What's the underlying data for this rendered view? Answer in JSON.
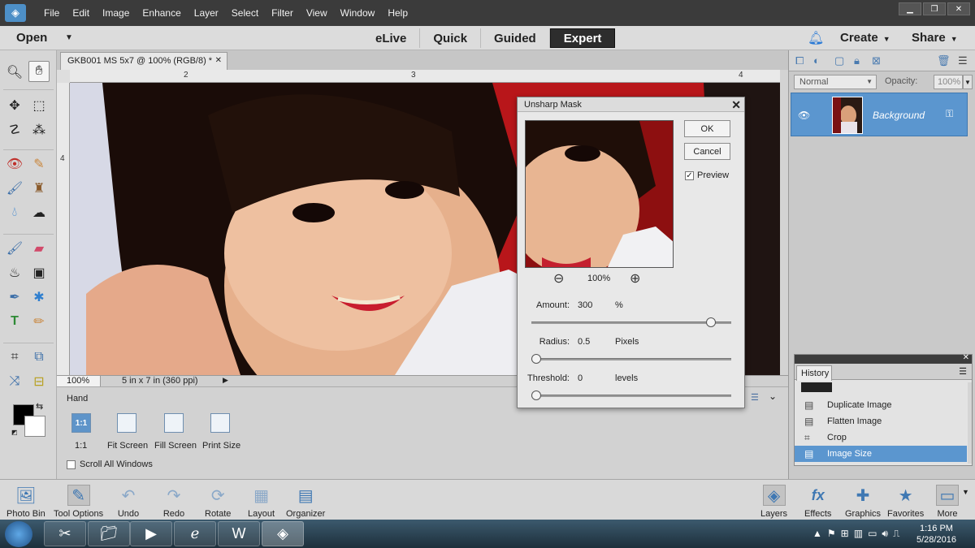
{
  "menubar": {
    "items": [
      "File",
      "Edit",
      "Image",
      "Enhance",
      "Layer",
      "Select",
      "Filter",
      "View",
      "Window",
      "Help"
    ]
  },
  "modebar": {
    "open_label": "Open",
    "tabs": [
      "eLive",
      "Quick",
      "Guided",
      "Expert"
    ],
    "active_tab": "Expert",
    "create_label": "Create",
    "share_label": "Share"
  },
  "document": {
    "tab_title": "GKB001 MS 5x7 @ 100% (RGB/8) *",
    "ruler_top_labels": [
      "2",
      "3",
      "4"
    ],
    "ruler_left_labels": [
      "4"
    ],
    "zoom": "100%",
    "info": "5 in x 7 in (360 ppi)"
  },
  "tool_options": {
    "tool_name": "Hand",
    "buttons": [
      "1:1",
      "Fit Screen",
      "Fill Screen",
      "Print Size"
    ],
    "active_button_glyph": "1:1",
    "scroll_all_label": "Scroll All Windows"
  },
  "layers": {
    "blend_mode": "Normal",
    "opacity_label": "Opacity:",
    "opacity_value": "100%",
    "layer_name": "Background"
  },
  "history": {
    "tab_label": "History",
    "items": [
      "Duplicate Image",
      "Flatten Image",
      "Crop",
      "Image Size"
    ],
    "selected": "Image Size"
  },
  "dialog": {
    "title": "Unsharp Mask",
    "ok_label": "OK",
    "cancel_label": "Cancel",
    "preview_label": "Preview",
    "preview_checked": true,
    "zoom": "100%",
    "amount_label": "Amount:",
    "amount_value": "300",
    "amount_unit": "%",
    "amount_fraction": 0.92,
    "radius_label": "Radius:",
    "radius_value": "0.5",
    "radius_unit": "Pixels",
    "radius_fraction": 0.0,
    "threshold_label": "Threshold:",
    "threshold_value": "0",
    "threshold_unit": "levels",
    "threshold_fraction": 0.0
  },
  "bottom_bar": {
    "left": [
      "Photo Bin",
      "Tool Options",
      "Undo",
      "Redo",
      "Rotate",
      "Layout",
      "Organizer"
    ],
    "right": [
      "Layers",
      "Effects",
      "Graphics",
      "Favorites",
      "More"
    ]
  },
  "taskbar": {
    "time": "1:16 PM",
    "date": "5/28/2016"
  },
  "colors": {
    "accent": "#5b96cf",
    "active_tab_bg": "#2d2d2d",
    "canvas_red": "#b8161a"
  }
}
